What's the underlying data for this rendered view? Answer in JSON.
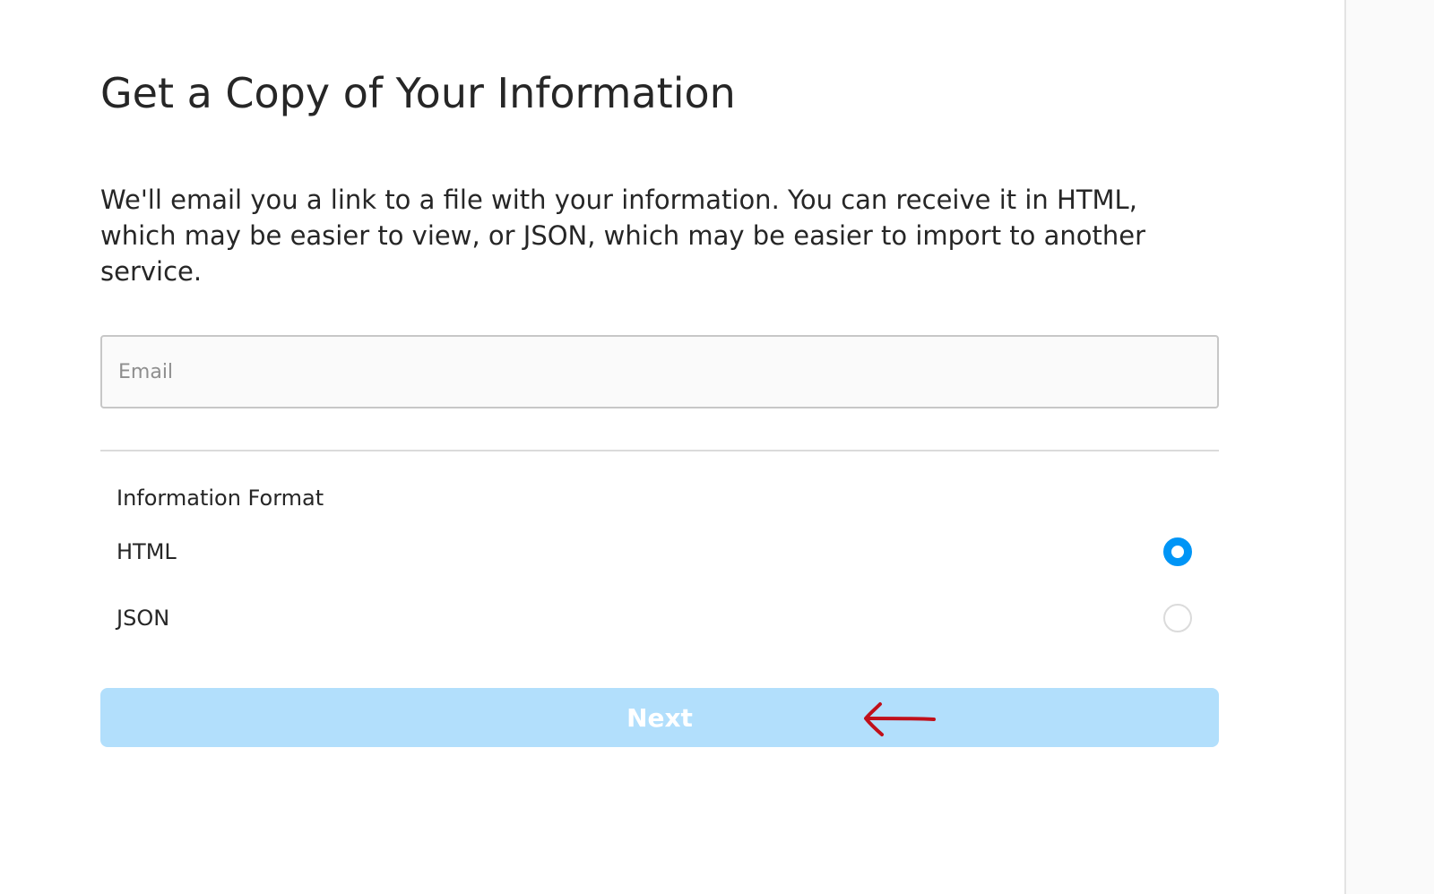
{
  "page": {
    "title": "Get a Copy of Your Information",
    "description": "We'll email you a link to a file with your information. You can receive it in HTML, which may be easier to view, or JSON, which may be easier to import to another service."
  },
  "email": {
    "placeholder": "Email",
    "value": ""
  },
  "format": {
    "label": "Information Format",
    "options": [
      {
        "label": "HTML",
        "selected": true
      },
      {
        "label": "JSON",
        "selected": false
      }
    ]
  },
  "next_button": {
    "label": "Next",
    "enabled": false
  },
  "colors": {
    "accent": "#0095f6",
    "button_disabled": "#b2dffc",
    "annotation_arrow": "#c0101a",
    "text": "#262626",
    "placeholder": "#8e8e8e"
  },
  "annotation": {
    "icon": "left-arrow-annotation-icon"
  }
}
